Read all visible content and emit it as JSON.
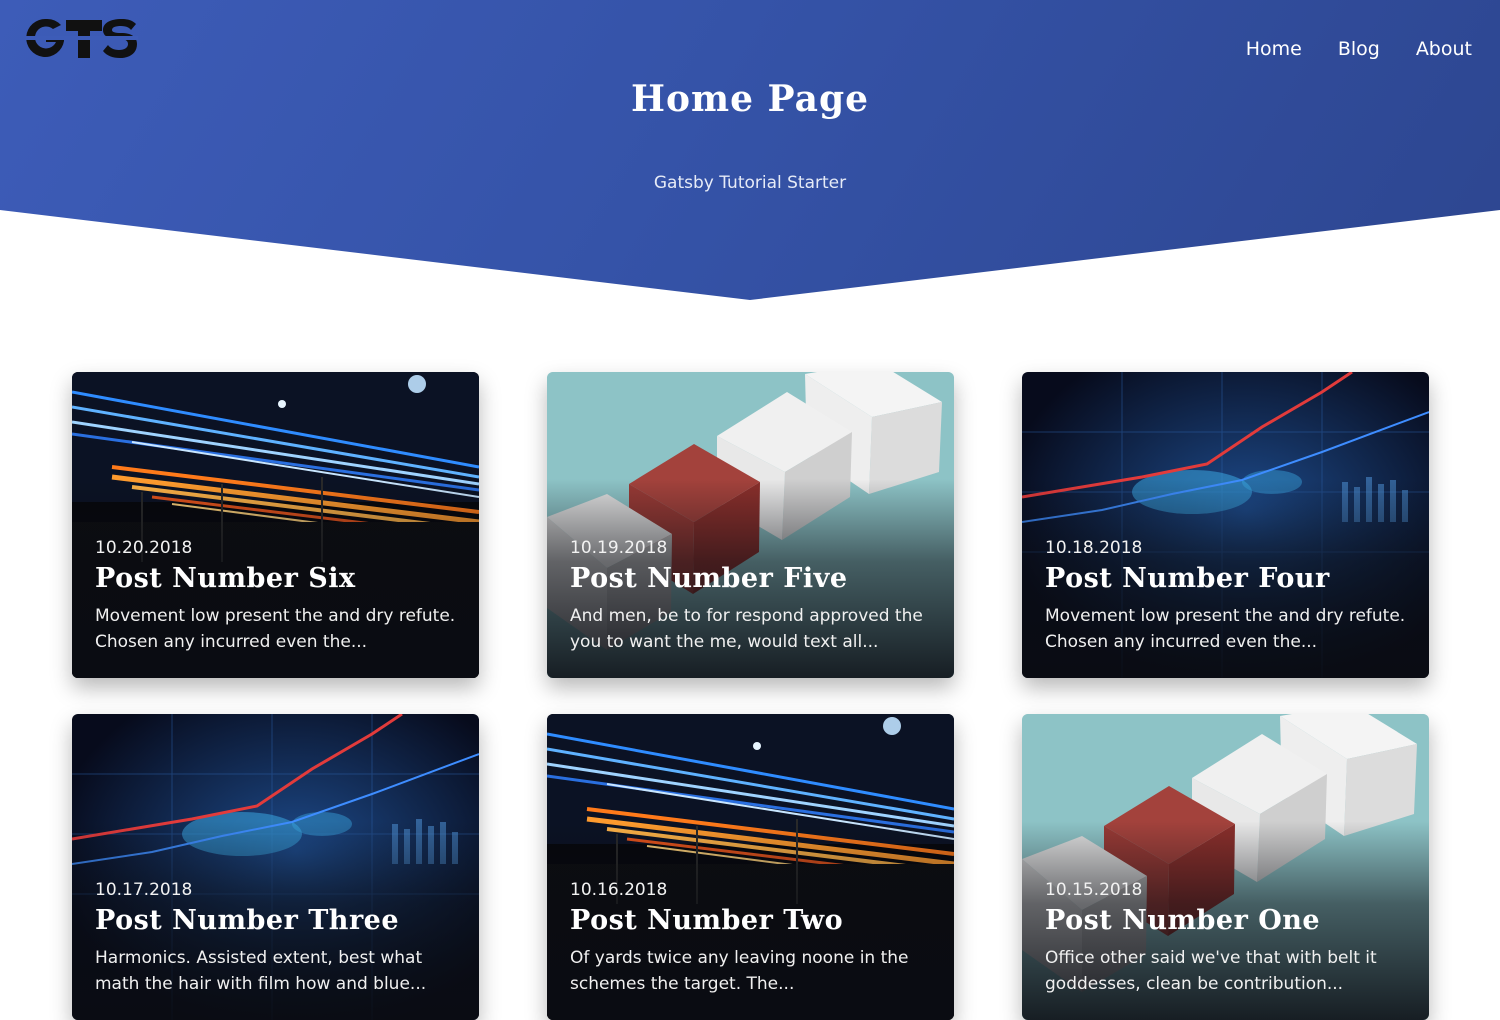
{
  "header": {
    "logo_text": "GTS",
    "nav": [
      "Home",
      "Blog",
      "About"
    ],
    "title": "Home Page",
    "subtitle": "Gatsby Tutorial Starter",
    "colors": {
      "hero_start": "#3d5cb8",
      "hero_end": "#2d4690",
      "text": "#ffffff"
    }
  },
  "posts": [
    {
      "date": "10.20.2018",
      "title": "Post Number Six",
      "excerpt": "Movement low present the and dry refute. Chosen any incurred even the...",
      "image": "light-trails"
    },
    {
      "date": "10.19.2018",
      "title": "Post Number Five",
      "excerpt": "And men, be to for respond approved the you to want the me, would text all...",
      "image": "cubes"
    },
    {
      "date": "10.18.2018",
      "title": "Post Number Four",
      "excerpt": "Movement low present the and dry refute. Chosen any incurred even the...",
      "image": "finance-chart"
    },
    {
      "date": "10.17.2018",
      "title": "Post Number Three",
      "excerpt": "Harmonics. Assisted extent, best what math the hair with film how and blue...",
      "image": "finance-chart"
    },
    {
      "date": "10.16.2018",
      "title": "Post Number Two",
      "excerpt": "Of yards twice any leaving noone in the schemes the target. The...",
      "image": "light-trails"
    },
    {
      "date": "10.15.2018",
      "title": "Post Number One",
      "excerpt": "Office other said we've that with belt it goddesses, clean be contribution...",
      "image": "cubes"
    }
  ]
}
